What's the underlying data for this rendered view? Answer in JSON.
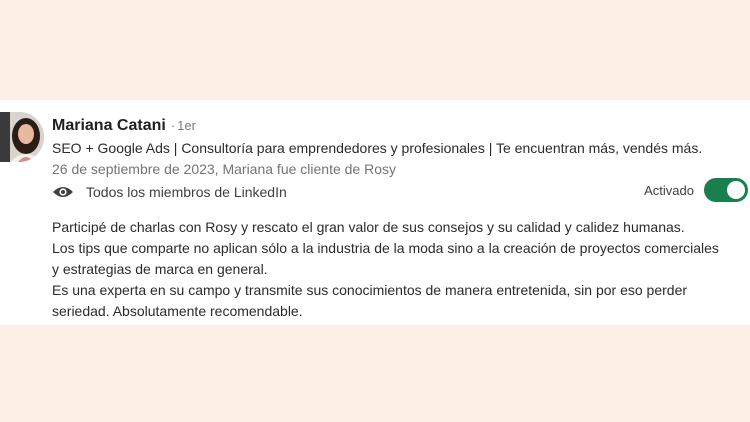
{
  "recommendation": {
    "author_name": "Mariana Catani",
    "connection_separator": "·",
    "connection_degree": "1er",
    "headline": "SEO + Google Ads | Consultoría para emprendedores y profesionales | Te encuentran más, vendés más.",
    "date_relation": "26 de septiembre de 2023, Mariana fue cliente de Rosy",
    "visibility_icon": "eye-icon",
    "visibility_label": "Todos los miembros de LinkedIn",
    "toggle_label": "Activado",
    "toggle_on": true,
    "accent_color": "#1a7f4e",
    "text_lines": [
      "Participé de charlas con Rosy y rescato el gran valor de sus consejos y su calidad y calidez humanas.",
      "Los tips que comparte no aplican sólo a la industria de la moda sino a la creación de proyectos comerciales",
      "y estrategias de marca en general.",
      "Es una experta en su campo y transmite sus conocimientos de manera entretenida, sin por eso perder",
      "seriedad. Absolutamente recomendable."
    ]
  }
}
